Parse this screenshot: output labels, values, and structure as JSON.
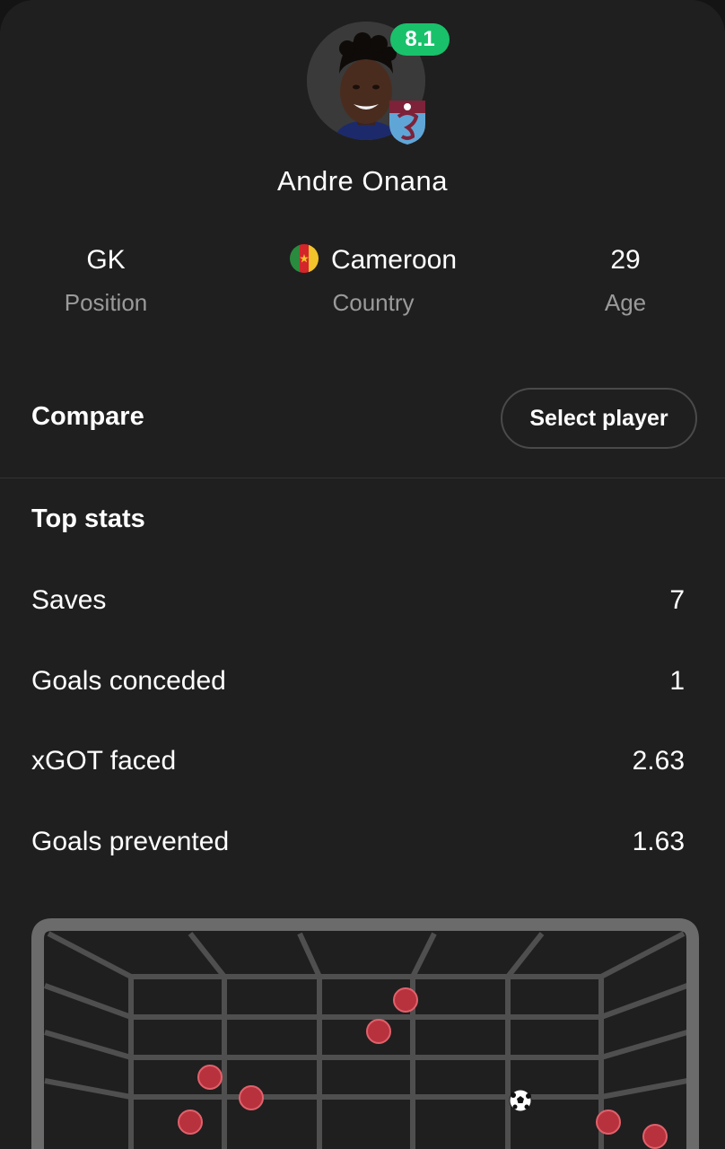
{
  "player": {
    "name": "Andre Onana",
    "rating": "8.1",
    "rating_color": "#19c16b",
    "club_badge": "trabzonspor-badge-icon"
  },
  "info": {
    "position": {
      "value": "GK",
      "label": "Position"
    },
    "country": {
      "value": "Cameroon",
      "label": "Country",
      "flag": "cameroon-flag-icon"
    },
    "age": {
      "value": "29",
      "label": "Age"
    }
  },
  "compare": {
    "title": "Compare",
    "button": "Select player"
  },
  "top_stats": {
    "title": "Top stats",
    "rows": [
      {
        "label": "Saves",
        "value": "7"
      },
      {
        "label": "Goals conceded",
        "value": "1"
      },
      {
        "label": "xGOT faced",
        "value": "2.63"
      },
      {
        "label": "Goals prevented",
        "value": "1.63"
      }
    ]
  },
  "shot_map": {
    "save_color": "#b8323e",
    "goal_icon": "football-icon"
  }
}
